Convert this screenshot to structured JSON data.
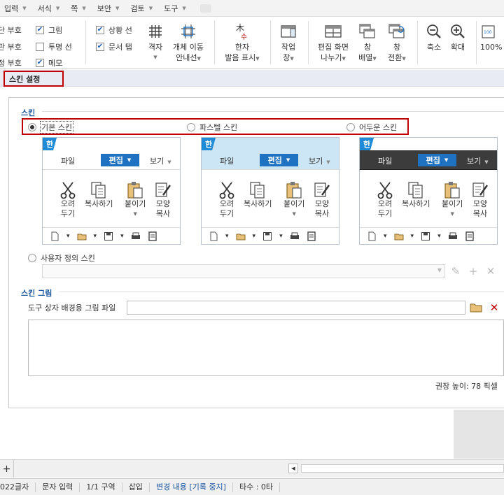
{
  "menubar": {
    "items": [
      "입력",
      "서식",
      "쪽",
      "보안",
      "검토",
      "도구"
    ]
  },
  "ribbon": {
    "checks": [
      {
        "label": "단 부호",
        "checked": false
      },
      {
        "label": "판 부호",
        "checked": false
      },
      {
        "label": "정 부호",
        "checked": true
      },
      {
        "label": "그림",
        "checked": true
      },
      {
        "label": "투명 선",
        "checked": false
      },
      {
        "label": "메모",
        "checked": true
      },
      {
        "label": "상황 선",
        "checked": true
      },
      {
        "label": "문서 탭",
        "checked": true
      }
    ],
    "buttons": {
      "grid_l1": "격자",
      "guide_l1": "개체 이동",
      "guide_l2": "안내선",
      "hanja_l1": "한자",
      "hanja_l2": "발음 표시",
      "work_l1": "작업",
      "work_l2": "창",
      "split_l1": "편집 화면",
      "split_l2": "나누기",
      "arrange_l1": "창",
      "arrange_l2": "배열",
      "switch_l1": "창",
      "switch_l2": "전환",
      "zoomout": "축소",
      "zoomin": "확대",
      "zoom100": "100%"
    }
  },
  "title": "스킨 설정",
  "skin_section": {
    "title": "스킨",
    "options": [
      "기본 스킨",
      "파스텔 스킨",
      "어두운 스킨"
    ],
    "selected": "기본 스킨",
    "logo": "한",
    "preview": {
      "tab_file": "파일",
      "tab_edit": "편집",
      "tab_view": "보기",
      "cut_l1": "오려",
      "cut_l2": "두기",
      "copy": "복사하기",
      "paste": "붙이기",
      "fmt_l1": "모양",
      "fmt_l2": "복사"
    },
    "custom_option": "사용자 정의 스킨"
  },
  "picture_section": {
    "title": "스킨 그림",
    "field_label": "도구 상자 배경용 그림 파일",
    "field_value": "",
    "hint": "권장 높이: 78 픽셀"
  },
  "statusbar": {
    "items": [
      "022글자",
      "문자 입력",
      "1/1 구역",
      "삽입",
      "변경 내용 [기록 중지]",
      "타수 : 0타"
    ]
  },
  "colors": {
    "accent": "#1f72c2",
    "highlight": "#c00000",
    "pastel": "#cce6f5",
    "dark": "#3c3c3c"
  }
}
